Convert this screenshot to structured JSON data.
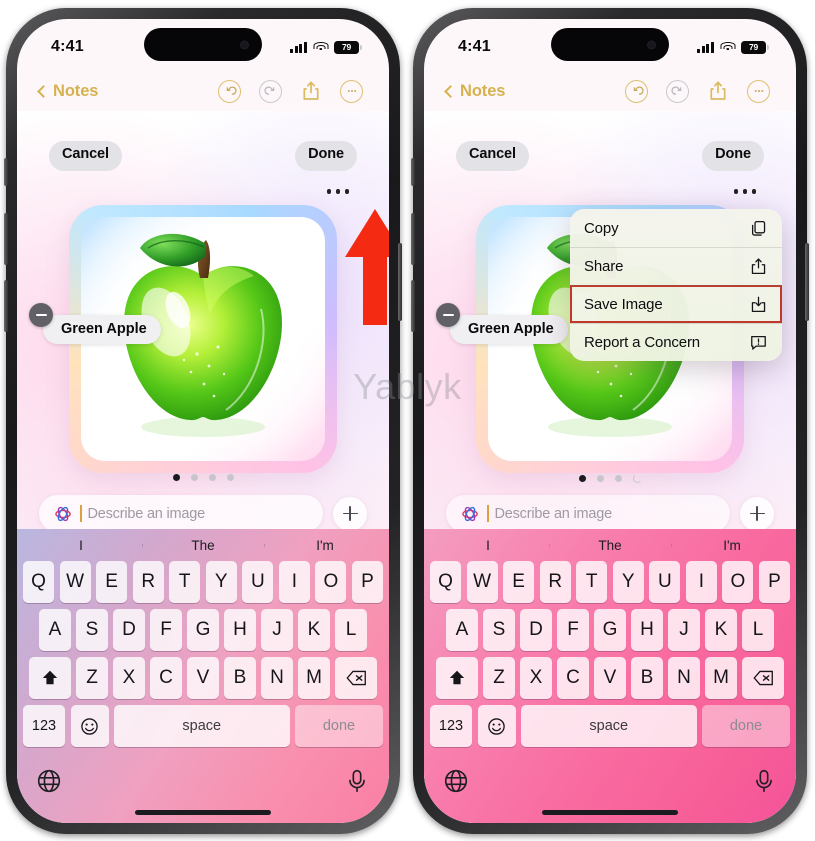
{
  "watermark": "Yablyk",
  "status_bar": {
    "time": "4:41",
    "battery_level": "79",
    "signal_icon": "cellular-bars-icon",
    "wifi_icon": "wifi-icon",
    "battery_icon": "battery-icon"
  },
  "nav_bar": {
    "back_label": "Notes",
    "back_chevron_icon": "chevron-left-icon",
    "undo_icon": "undo-circle-icon",
    "redo_icon": "redo-circle-icon",
    "share_icon": "share-square-up-icon",
    "more_icon": "ellipsis-circle-icon",
    "accent_color": "#d6b24f",
    "disabled_color": "#c9c9ce"
  },
  "playground": {
    "cancel_label": "Cancel",
    "done_label": "Done",
    "more_dots_icon": "ellipsis-icon",
    "concept_chip_label": "Green Apple",
    "remove_icon": "minus-circle-icon",
    "image_alt": "green-apple-illustration",
    "prompt_placeholder": "Describe an image",
    "prompt_value": "",
    "playground_icon": "image-playground-icon",
    "add_icon": "plus-icon"
  },
  "page_dots": {
    "left": {
      "count": 4,
      "active_index": 0,
      "has_spinner": false
    },
    "right": {
      "count": 3,
      "active_index": 0,
      "has_spinner": true,
      "spinner_icon": "loading-spinner-icon"
    }
  },
  "context_menu": {
    "highlight_color": "#c0392b",
    "items": [
      {
        "label": "Copy",
        "icon": "copy-icon",
        "highlighted": false
      },
      {
        "label": "Share",
        "icon": "share-icon",
        "highlighted": false
      },
      {
        "label": "Save Image",
        "icon": "download-icon",
        "highlighted": true
      },
      {
        "label": "Report a Concern",
        "icon": "report-icon",
        "highlighted": false
      }
    ]
  },
  "annotation": {
    "arrow_icon": "red-arrow-up-icon",
    "arrow_color": "#f42b12"
  },
  "keyboard": {
    "predictions": [
      "I",
      "The",
      "I'm"
    ],
    "row1": [
      "Q",
      "W",
      "E",
      "R",
      "T",
      "Y",
      "U",
      "I",
      "O",
      "P"
    ],
    "row2": [
      "A",
      "S",
      "D",
      "F",
      "G",
      "H",
      "J",
      "K",
      "L"
    ],
    "row3": [
      "Z",
      "X",
      "C",
      "V",
      "B",
      "N",
      "M"
    ],
    "shift_icon": "shift-arrow-icon",
    "backspace_icon": "backspace-icon",
    "numbers_label": "123",
    "emoji_icon": "emoji-smiley-icon",
    "space_label": "space",
    "done_label": "done",
    "globe_icon": "globe-icon",
    "mic_icon": "microphone-icon"
  }
}
